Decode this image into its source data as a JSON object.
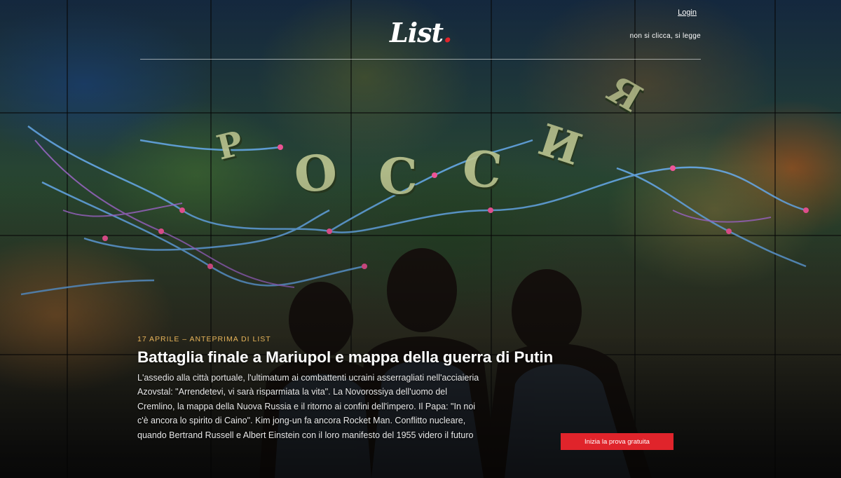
{
  "header": {
    "logo_text": "List",
    "logo_dot": ".",
    "login_label": "Login",
    "tagline": "non si clicca, si legge"
  },
  "hero_image": {
    "map_letters": [
      "Р",
      "О",
      "С",
      "С",
      "И",
      "Я"
    ]
  },
  "article": {
    "kicker": "17 aprile – anteprima di List",
    "headline": "Battaglia finale a Mariupol e mappa della guerra di Putin",
    "summary": "L'assedio alla città portuale, l'ultimatum ai combattenti ucraini asserragliati nell'acciaieria Azovstal: \"Arrendetevi, vi sarà risparmiata la vita\". La Novorossiya dell'uomo del Cremlino, la mappa della Nuova Russia e il ritorno ai confini dell'impero. Il Papa: \"In noi c'è ancora lo spirito di Caino\". Kim jong-un fa ancora Rocket Man. Conflitto nucleare, quando Bertrand Russell e Albert Einstein con il loro manifesto del 1955 videro il futuro"
  },
  "cta": {
    "label": "Inizia la prova gratuita"
  },
  "colors": {
    "accent": "#e0242b",
    "kicker": "#e7b45a"
  }
}
